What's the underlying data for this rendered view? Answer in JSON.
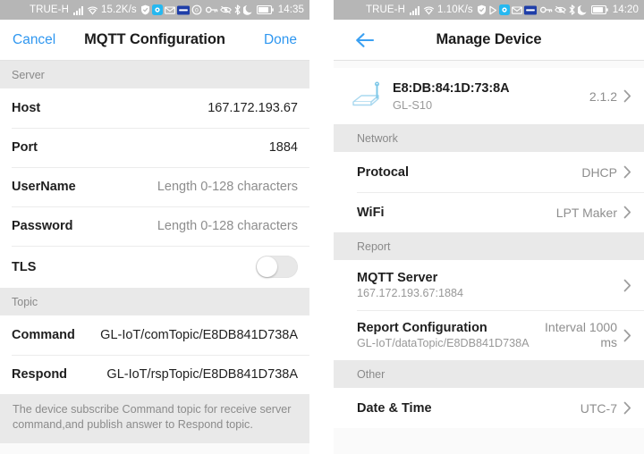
{
  "left": {
    "statusbar": {
      "carrier": "TRUE-H",
      "speed": "15.2K/s",
      "time": "14:35",
      "icons": [
        "signal-bars-icon",
        "wifi-icon",
        "shield-icon",
        "app-blue-icon",
        "message-icon",
        "card-icon",
        "do-not-disturb-icon",
        "key-icon",
        "eye-off-icon",
        "bluetooth-icon",
        "moon-icon",
        "battery-icon"
      ]
    },
    "nav": {
      "cancel_label": "Cancel",
      "title": "MQTT Configuration",
      "done_label": "Done"
    },
    "sections": [
      {
        "header": "Server",
        "rows": [
          {
            "label": "Host",
            "value": "167.172.193.67",
            "muted": false,
            "type": "value"
          },
          {
            "label": "Port",
            "value": "1884",
            "muted": false,
            "type": "value"
          },
          {
            "label": "UserName",
            "value": "Length 0-128 characters",
            "muted": true,
            "type": "value"
          },
          {
            "label": "Password",
            "value": "Length 0-128 characters",
            "muted": true,
            "type": "value"
          },
          {
            "label": "TLS",
            "value": "",
            "muted": false,
            "type": "toggle",
            "toggle_on": false
          }
        ]
      },
      {
        "header": "Topic",
        "rows": [
          {
            "label": "Command",
            "value": "GL-IoT/comTopic/E8DB841D738A",
            "muted": false,
            "type": "value"
          },
          {
            "label": "Respond",
            "value": "GL-IoT/rspTopic/E8DB841D738A",
            "muted": false,
            "type": "value"
          }
        ]
      }
    ],
    "footnote": "The device subscribe Command topic for receive server command,and publish answer to Respond topic."
  },
  "right": {
    "statusbar": {
      "carrier": "TRUE-H",
      "speed": "1.10K/s",
      "time": "14:20",
      "icons": [
        "signal-bars-icon",
        "wifi-icon",
        "shield-icon",
        "play-icon",
        "app-blue-icon",
        "message-icon",
        "card-icon",
        "key-icon",
        "eye-off-icon",
        "bluetooth-icon",
        "moon-icon",
        "battery-icon"
      ]
    },
    "nav": {
      "back_label": "back-arrow",
      "title": "Manage Device"
    },
    "device": {
      "icon": "router-icon",
      "mac": "E8:DB:84:1D:73:8A",
      "model": "GL-S10",
      "version": "2.1.2"
    },
    "sections": [
      {
        "header": "Network",
        "rows": [
          {
            "title": "Protocal",
            "sub": "",
            "value": "DHCP",
            "chevron": true
          },
          {
            "title": "WiFi",
            "sub": "",
            "value": "LPT Maker",
            "chevron": true
          }
        ]
      },
      {
        "header": "Report",
        "rows": [
          {
            "title": "MQTT Server",
            "sub": "167.172.193.67:1884",
            "value": "",
            "chevron": true
          },
          {
            "title": "Report Configuration",
            "sub": "GL-IoT/dataTopic/E8DB841D738A",
            "value": "Interval 1000 ms",
            "chevron": true
          }
        ]
      },
      {
        "header": "Other",
        "rows": [
          {
            "title": "Date & Time",
            "sub": "",
            "value": "UTC-7",
            "chevron": true
          }
        ]
      }
    ]
  }
}
